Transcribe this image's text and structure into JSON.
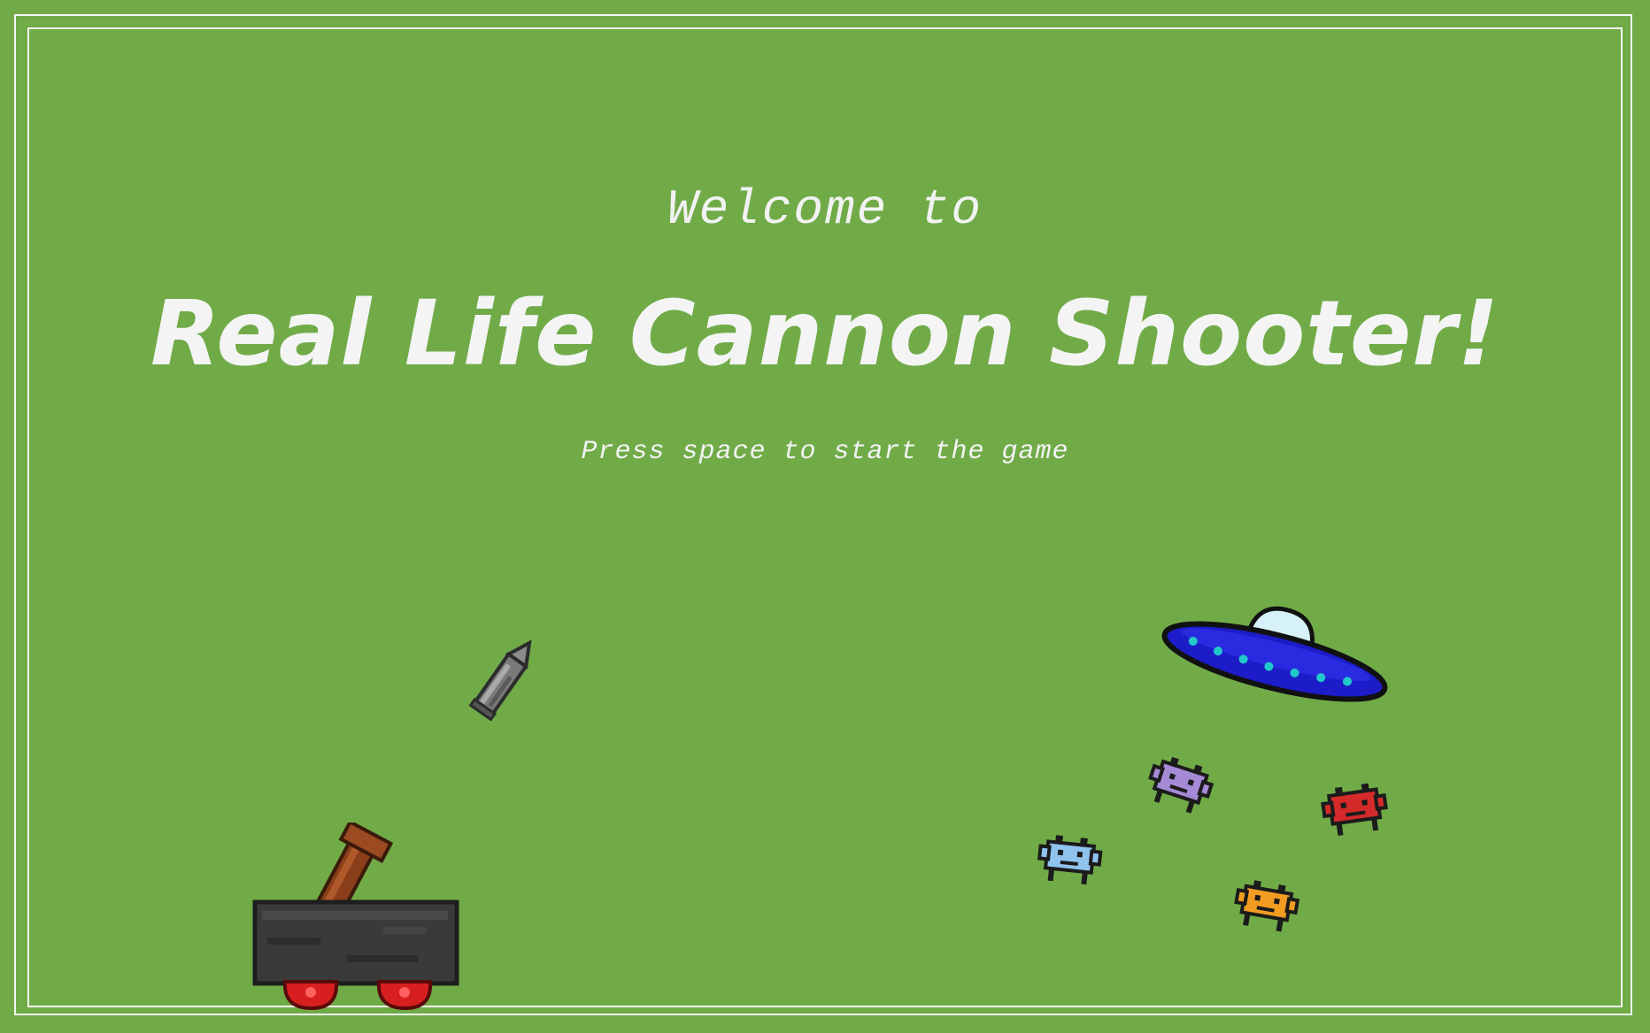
{
  "game": {
    "welcome_text": "Welcome to",
    "title": "Real Life Cannon Shooter!",
    "prompt": "Press space to start the game"
  },
  "sprites": {
    "cannon": "cannon-icon",
    "bullet": "bullet-icon",
    "ufo": "ufo-icon",
    "aliens": [
      "alien-purple-icon",
      "alien-red-icon",
      "alien-blue-icon",
      "alien-orange-icon"
    ]
  },
  "colors": {
    "background": "#70ab48",
    "text": "#f4f4f4",
    "frame": "#f4f4f4"
  }
}
